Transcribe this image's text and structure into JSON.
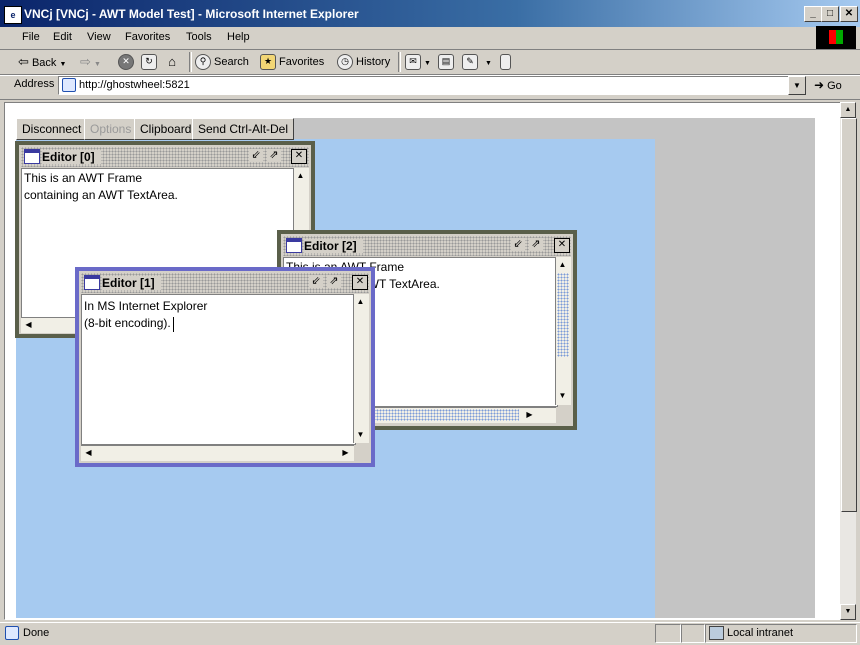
{
  "window": {
    "title": "VNCj [VNCj - AWT Model Test] - Microsoft Internet Explorer",
    "minimize": "_",
    "maximize": "□",
    "close": "✕"
  },
  "menu": [
    "File",
    "Edit",
    "View",
    "Favorites",
    "Tools",
    "Help"
  ],
  "toolbar": {
    "back": "Back",
    "search": "Search",
    "favorites": "Favorites",
    "history": "History"
  },
  "address": {
    "label": "Address",
    "url": "http://ghostwheel:5821",
    "go": "Go"
  },
  "vnc_buttons": {
    "disconnect": "Disconnect",
    "options": "Options",
    "clipboard": "Clipboard",
    "send_cad": "Send Ctrl-Alt-Del"
  },
  "frames": {
    "editor0": {
      "title": "Editor [0]",
      "lines": [
        "This is an AWT Frame",
        "containing an AWT TextArea."
      ]
    },
    "editor2": {
      "title": "Editor [2]",
      "lines": [
        "This is an AWT Frame",
        "containing an AWT TextArea."
      ]
    },
    "editor1": {
      "title": "Editor [1]",
      "lines": [
        "In MS Internet Explorer",
        "(8-bit encoding)."
      ]
    }
  },
  "status": {
    "text": "Done",
    "zone": "Local intranet"
  },
  "colors": {
    "desktop": "#a6caf0",
    "active_frame_border": "#6a6ac8",
    "inactive_frame_border": "#5a5f4a"
  }
}
